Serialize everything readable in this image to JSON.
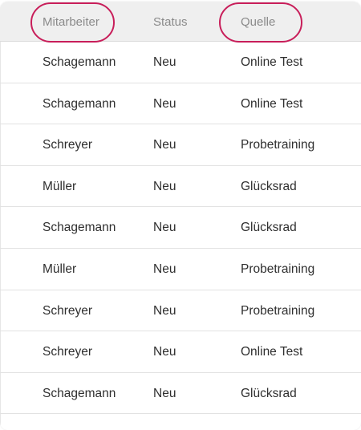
{
  "table": {
    "headers": [
      "Mitarbeiter",
      "Status",
      "Quelle"
    ],
    "highlight_color": "#c81e5a",
    "highlighted_columns": [
      "Mitarbeiter",
      "Quelle"
    ],
    "rows": [
      [
        "Schagemann",
        "Neu",
        "Online Test"
      ],
      [
        "Schagemann",
        "Neu",
        "Online Test"
      ],
      [
        "Schreyer",
        "Neu",
        "Probetraining"
      ],
      [
        "Müller",
        "Neu",
        "Glücksrad"
      ],
      [
        "Schagemann",
        "Neu",
        "Glücksrad"
      ],
      [
        "Müller",
        "Neu",
        "Probetraining"
      ],
      [
        "Schreyer",
        "Neu",
        "Probetraining"
      ],
      [
        "Schreyer",
        "Neu",
        "Online Test"
      ],
      [
        "Schagemann",
        "Neu",
        "Glücksrad"
      ]
    ]
  }
}
